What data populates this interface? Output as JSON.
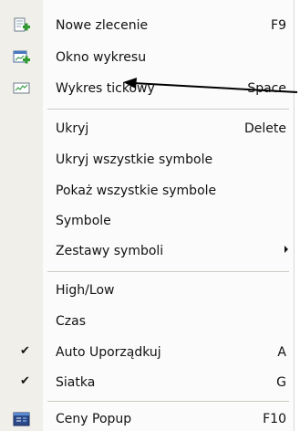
{
  "menu": {
    "items": [
      {
        "label": "Nowe zlecenie",
        "shortcut": "F9",
        "icon": "new-order-icon"
      },
      {
        "label": "Okno wykresu",
        "shortcut": "",
        "icon": "chart-window-icon"
      },
      {
        "label": "Wykres tickowy",
        "shortcut": "Space",
        "icon": "tick-chart-icon"
      },
      {
        "label": "Ukryj",
        "shortcut": "Delete"
      },
      {
        "label": "Ukryj wszystkie symbole",
        "shortcut": ""
      },
      {
        "label": "Pokaż wszystkie symbole",
        "shortcut": ""
      },
      {
        "label": "Symbole",
        "shortcut": ""
      },
      {
        "label": "Zestawy symboli",
        "shortcut": "",
        "submenu": true
      },
      {
        "label": "High/Low",
        "shortcut": ""
      },
      {
        "label": "Czas",
        "shortcut": ""
      },
      {
        "label": "Auto Uporządkuj",
        "shortcut": "A",
        "checked": true
      },
      {
        "label": "Siatka",
        "shortcut": "G",
        "checked": true
      },
      {
        "label": "Ceny Popup",
        "shortcut": "F10",
        "icon": "popup-prices-icon"
      }
    ]
  },
  "colors": {
    "gutter": "#f0efe9",
    "menu_background": "#fbfbfb",
    "text": "#111111",
    "separator": "#c9c8c2"
  }
}
